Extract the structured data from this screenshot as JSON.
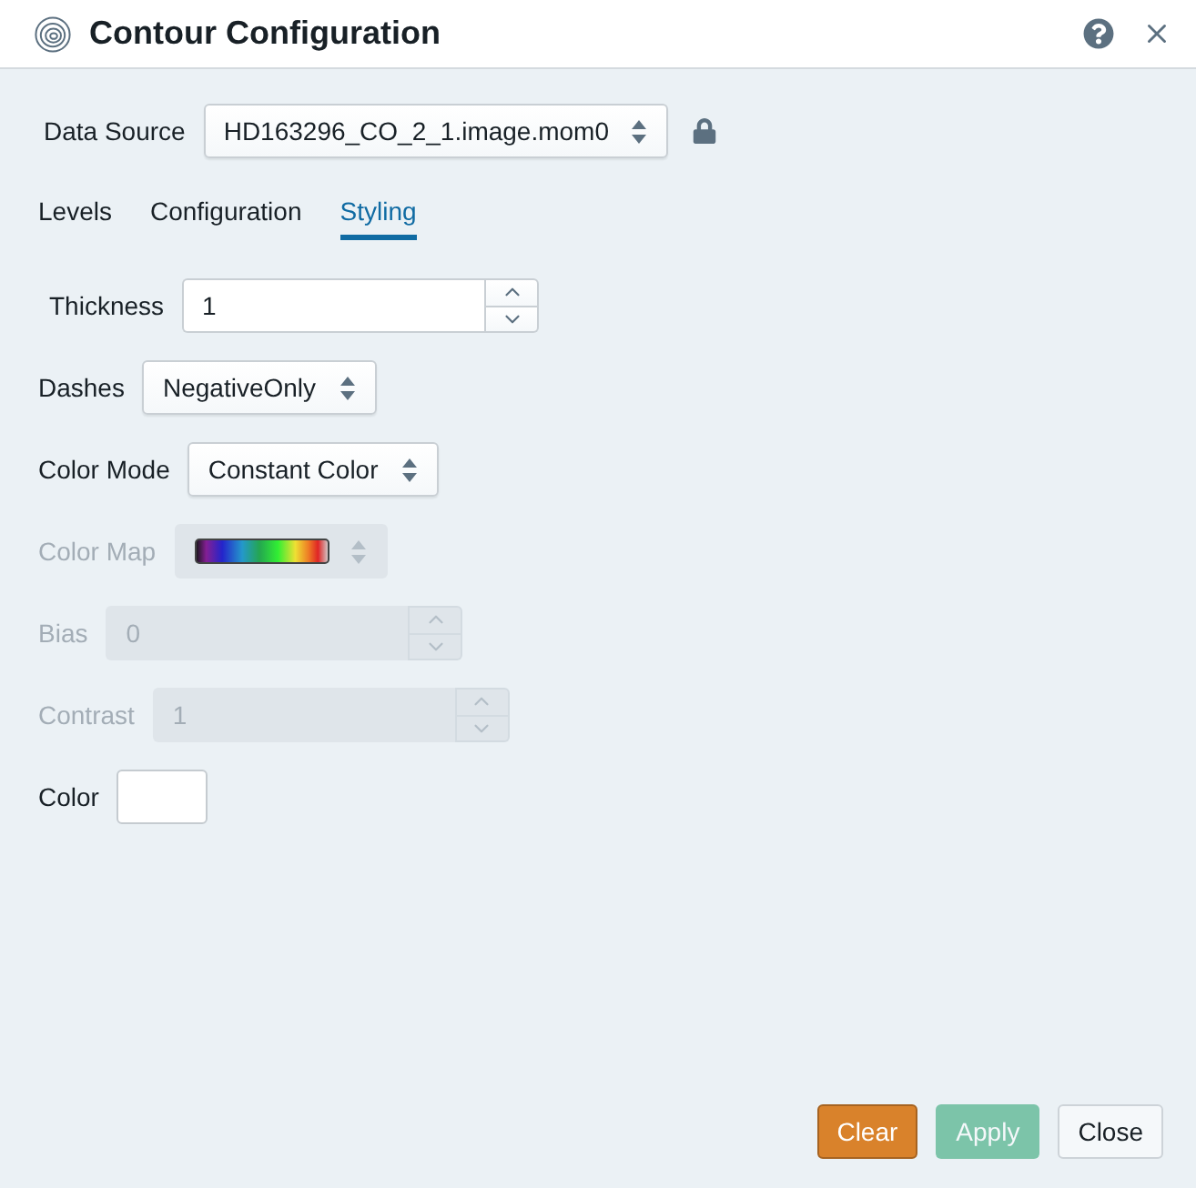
{
  "window": {
    "title": "Contour Configuration"
  },
  "data_source": {
    "label": "Data Source",
    "value": "HD163296_CO_2_1.image.mom0",
    "locked": true
  },
  "tabs": [
    {
      "label": "Levels",
      "selected": false
    },
    {
      "label": "Configuration",
      "selected": false
    },
    {
      "label": "Styling",
      "selected": true
    }
  ],
  "fields": [
    {
      "kind": "number",
      "label": "Thickness",
      "value": "1",
      "disabled": false
    },
    {
      "kind": "select",
      "label": "Dashes",
      "value": "NegativeOnly",
      "disabled": false
    },
    {
      "kind": "select",
      "label": "Color Mode",
      "value": "Constant Color",
      "disabled": false
    },
    {
      "kind": "colormap",
      "label": "Color Map",
      "disabled": true
    },
    {
      "kind": "number",
      "label": "Bias",
      "value": "0",
      "disabled": true
    },
    {
      "kind": "number",
      "label": "Contrast",
      "value": "1",
      "disabled": true
    },
    {
      "kind": "color",
      "label": "Color",
      "color": "#ffffff",
      "disabled": false
    }
  ],
  "buttons": [
    {
      "label": "Clear",
      "kind": "warning",
      "disabled": false
    },
    {
      "label": "Apply",
      "kind": "success",
      "disabled": true
    },
    {
      "label": "Close",
      "kind": "default",
      "disabled": false
    }
  ]
}
